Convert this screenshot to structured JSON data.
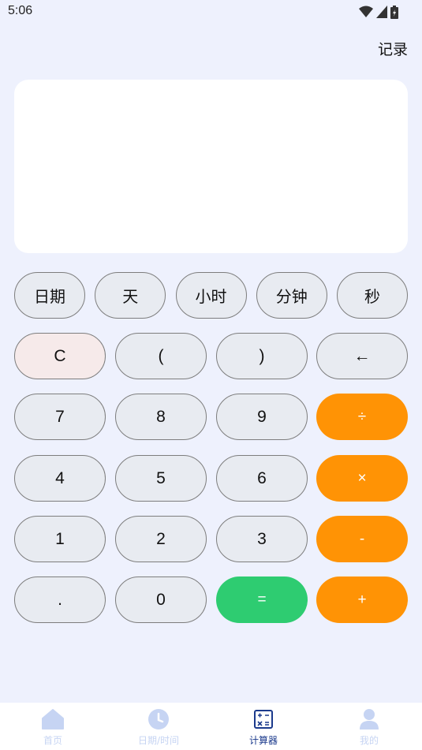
{
  "status_bar": {
    "time": "5:06"
  },
  "header": {
    "record_label": "记录"
  },
  "display": {
    "value": ""
  },
  "unit_buttons": [
    "日期",
    "天",
    "小时",
    "分钟",
    "秒"
  ],
  "keys": {
    "clear": "C",
    "lparen": "(",
    "rparen": ")",
    "backspace": "←",
    "k7": "7",
    "k8": "8",
    "k9": "9",
    "divide": "÷",
    "k4": "4",
    "k5": "5",
    "k6": "6",
    "multiply": "×",
    "k1": "1",
    "k2": "2",
    "k3": "3",
    "minus": "-",
    "dot": ".",
    "k0": "0",
    "equals": "=",
    "plus": "+"
  },
  "colors": {
    "operator": "#ff9305",
    "equals": "#2ecc71",
    "clear": "#f6eaea",
    "active_tab": "#1b3a8c",
    "inactive_tab": "#c6d4f3"
  },
  "tabs": [
    {
      "label": "首页",
      "icon": "home-icon",
      "active": false
    },
    {
      "label": "日期/时间",
      "icon": "clock-icon",
      "active": false
    },
    {
      "label": "计算器",
      "icon": "calculator-icon",
      "active": true
    },
    {
      "label": "我的",
      "icon": "user-icon",
      "active": false
    }
  ]
}
